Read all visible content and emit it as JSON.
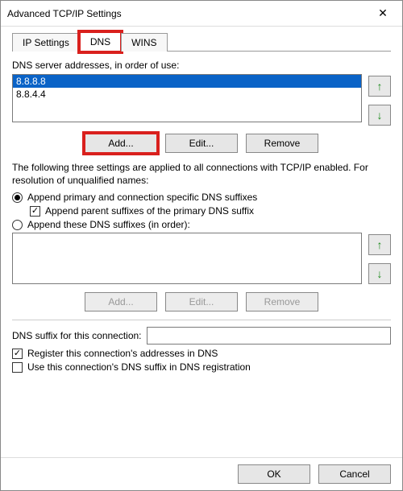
{
  "window": {
    "title": "Advanced TCP/IP Settings"
  },
  "tabs": {
    "ip": "IP Settings",
    "dns": "DNS",
    "wins": "WINS"
  },
  "dns": {
    "server_label": "DNS server addresses, in order of use:",
    "servers": [
      "8.8.8.8",
      "8.8.4.4"
    ],
    "add": "Add...",
    "edit": "Edit...",
    "remove": "Remove",
    "explain": "The following three settings are applied to all connections with TCP/IP enabled. For resolution of unqualified names:",
    "radio_primary": "Append primary and connection specific DNS suffixes",
    "check_parent": "Append parent suffixes of the primary DNS suffix",
    "radio_these": "Append these DNS suffixes (in order):",
    "suffix_add": "Add...",
    "suffix_edit": "Edit...",
    "suffix_remove": "Remove",
    "suffix_label": "DNS suffix for this connection:",
    "suffix_value": "",
    "check_register": "Register this connection's addresses in DNS",
    "check_usesuffix": "Use this connection's DNS suffix in DNS registration"
  },
  "footer": {
    "ok": "OK",
    "cancel": "Cancel"
  }
}
